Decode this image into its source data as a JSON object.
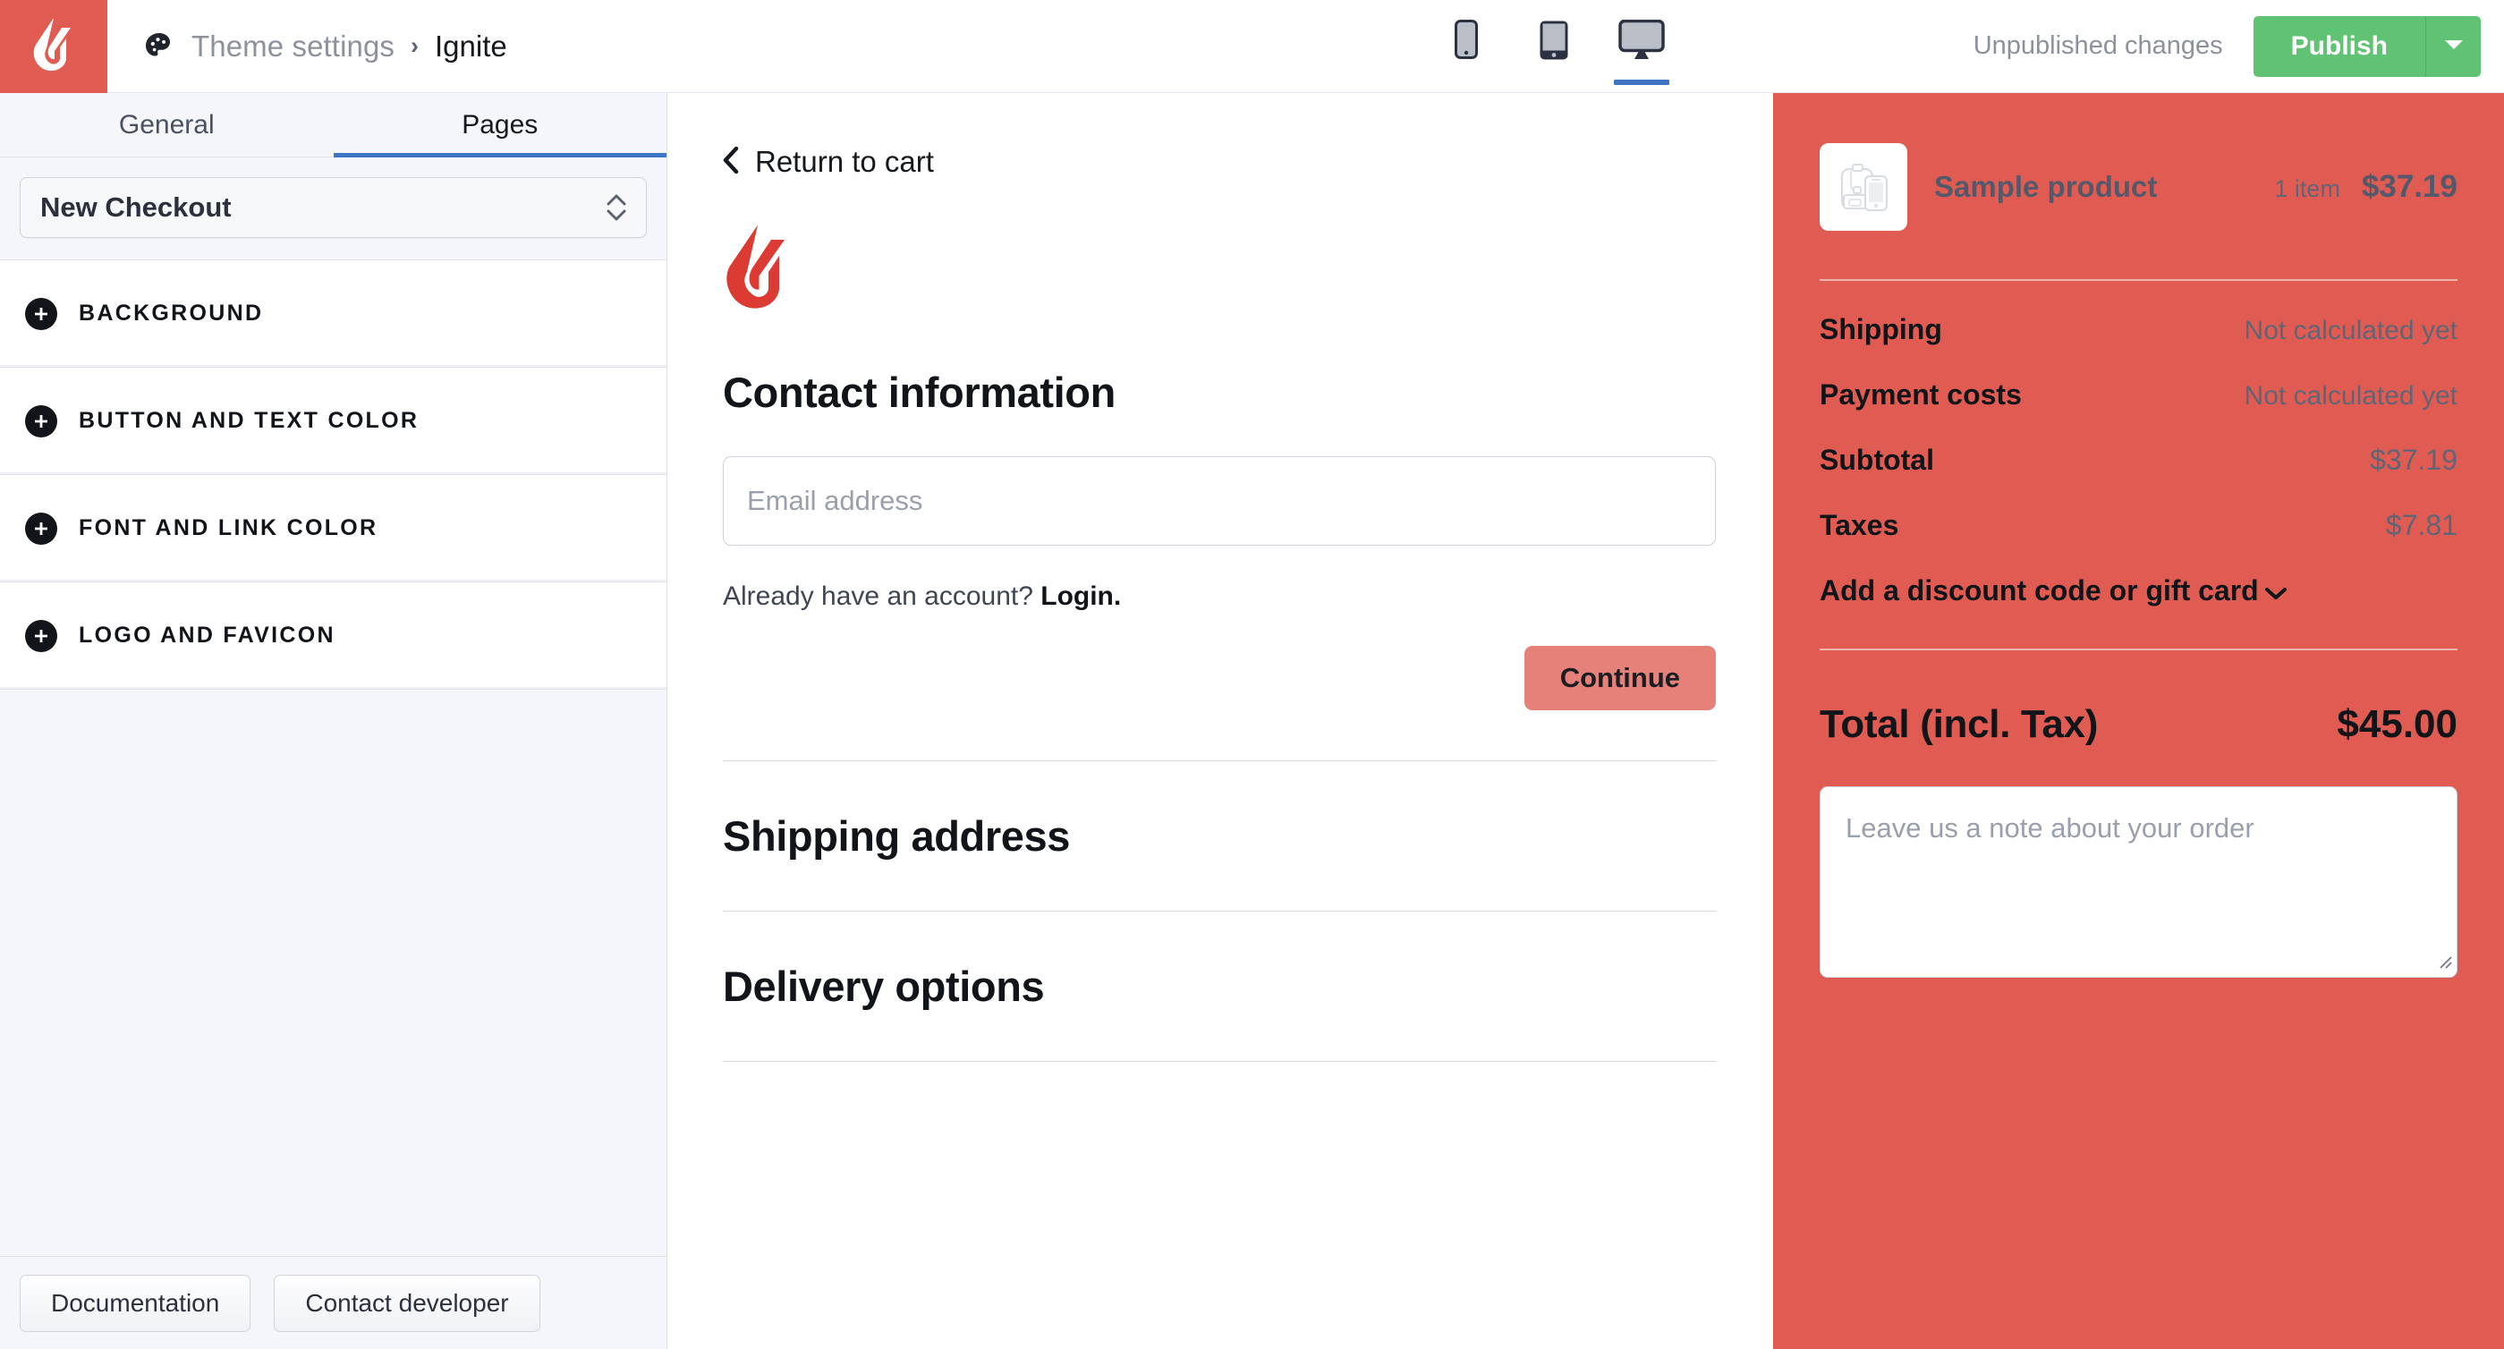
{
  "colors": {
    "brand_red": "#e05c53",
    "accent_blue": "#3e74c4",
    "publish_green": "#5fc373",
    "continue_salmon": "#e58179",
    "sidebar_bg": "#f4f6f9"
  },
  "topbar": {
    "logo_icon": "lightspeed-flame-icon",
    "palette_icon": "palette-icon",
    "breadcrumb_parent": "Theme settings",
    "breadcrumb_separator": "›",
    "breadcrumb_current": "Ignite",
    "devices": [
      {
        "name": "mobile",
        "icon": "mobile-icon",
        "active": false
      },
      {
        "name": "tablet",
        "icon": "tablet-icon",
        "active": false
      },
      {
        "name": "desktop",
        "icon": "desktop-icon",
        "active": true
      }
    ],
    "status_text": "Unpublished changes",
    "publish_label": "Publish",
    "publish_caret_icon": "caret-down-icon"
  },
  "sidebar": {
    "tabs": [
      {
        "label": "General",
        "active": false
      },
      {
        "label": "Pages",
        "active": true
      }
    ],
    "page_select": {
      "value": "New Checkout",
      "stepper_icon": "up-down-chevron-icon"
    },
    "sections": [
      {
        "label": "BACKGROUND",
        "icon": "plus-circle-icon"
      },
      {
        "label": "BUTTON AND TEXT COLOR",
        "icon": "plus-circle-icon"
      },
      {
        "label": "FONT AND LINK COLOR",
        "icon": "plus-circle-icon"
      },
      {
        "label": "LOGO AND FAVICON",
        "icon": "plus-circle-icon"
      }
    ],
    "footer": {
      "documentation_label": "Documentation",
      "contact_label": "Contact developer"
    }
  },
  "preview": {
    "return_link": {
      "label": "Return to cart",
      "icon": "chevron-left-icon"
    },
    "shop_logo_icon": "lightspeed-flame-logo",
    "contact": {
      "title": "Contact information",
      "email_placeholder": "Email address",
      "email_value": "",
      "account_prompt": "Already have an account? ",
      "login_link": "Login.",
      "continue_label": "Continue"
    },
    "shipping": {
      "title": "Shipping address"
    },
    "delivery": {
      "title": "Delivery options"
    }
  },
  "summary": {
    "product": {
      "thumbnail_icon": "backpack-phone-placeholder-icon",
      "name": "Sample product",
      "quantity": "1 item",
      "price": "$37.19"
    },
    "lines": [
      {
        "key": "Shipping",
        "value": "Not calculated yet",
        "numeric": false
      },
      {
        "key": "Payment costs",
        "value": "Not calculated yet",
        "numeric": false
      },
      {
        "key": "Subtotal",
        "value": "$37.19",
        "numeric": true
      },
      {
        "key": "Taxes",
        "value": "$7.81",
        "numeric": true
      }
    ],
    "discount_label": "Add a discount code or gift card",
    "discount_icon": "chevron-down-icon",
    "total_label": "Total (incl. Tax)",
    "total_value": "$45.00",
    "note_placeholder": "Leave us a note about your order",
    "note_value": ""
  }
}
